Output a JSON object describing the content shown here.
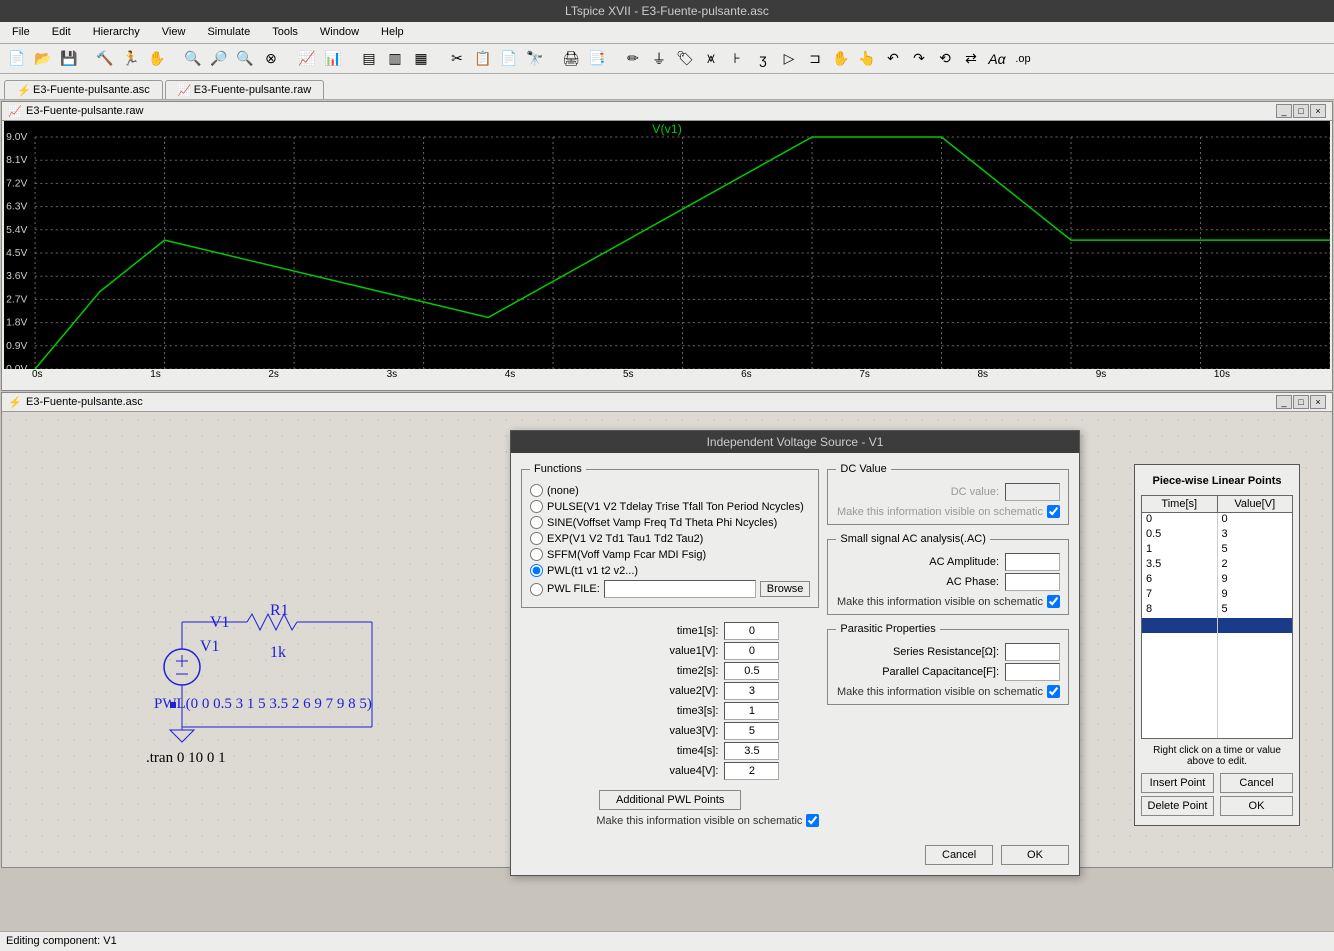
{
  "app": {
    "title": "LTspice XVII - E3-Fuente-pulsante.asc"
  },
  "menu": [
    "File",
    "Edit",
    "Hierarchy",
    "View",
    "Simulate",
    "Tools",
    "Window",
    "Help"
  ],
  "tabs": [
    {
      "label": "E3-Fuente-pulsante.asc"
    },
    {
      "label": "E3-Fuente-pulsante.raw"
    }
  ],
  "wave_pane_title": "E3-Fuente-pulsante.raw",
  "sch_pane_title": "E3-Fuente-pulsante.asc",
  "status": "Editing component: V1",
  "chart_data": {
    "type": "line",
    "title": "V(v1)",
    "xlabel": "",
    "ylabel": "",
    "xlim": [
      0,
      10
    ],
    "ylim": [
      0,
      9
    ],
    "x_ticks": [
      "0s",
      "1s",
      "2s",
      "3s",
      "4s",
      "5s",
      "6s",
      "7s",
      "8s",
      "9s",
      "10s"
    ],
    "y_ticks": [
      "0.0V",
      "0.9V",
      "1.8V",
      "2.7V",
      "3.6V",
      "4.5V",
      "5.4V",
      "6.3V",
      "7.2V",
      "8.1V",
      "9.0V"
    ],
    "series": [
      {
        "name": "V(v1)",
        "color": "#00c800",
        "x": [
          0,
          0.5,
          1,
          3.5,
          6,
          7,
          8,
          10
        ],
        "y": [
          0,
          3,
          5,
          2,
          9,
          9,
          5,
          5
        ]
      }
    ]
  },
  "schematic": {
    "r1_name": "R1",
    "r1_val": "1k",
    "v1_name": "V1",
    "v1_node": "V1",
    "pwl": "PWL(0 0 0.5 3 1 5 3.5 2 6 9 7 9 8 5)",
    "tran": ".tran 0 10 0 1"
  },
  "dlg": {
    "title": "Independent Voltage Source - V1",
    "functions_legend": "Functions",
    "fn_none": "(none)",
    "fn_pulse": "PULSE(V1 V2 Tdelay Trise Tfall Ton Period Ncycles)",
    "fn_sine": "SINE(Voffset Vamp Freq Td Theta Phi Ncycles)",
    "fn_exp": "EXP(V1 V2 Td1 Tau1 Td2 Tau2)",
    "fn_sffm": "SFFM(Voff Vamp Fcar MDI Fsig)",
    "fn_pwl": "PWL(t1 v1 t2 v2...)",
    "fn_pwlfile": "PWL FILE:",
    "browse": "Browse",
    "pwl_fields": [
      {
        "label": "time1[s]:",
        "val": "0"
      },
      {
        "label": "value1[V]:",
        "val": "0"
      },
      {
        "label": "time2[s]:",
        "val": "0.5"
      },
      {
        "label": "value2[V]:",
        "val": "3"
      },
      {
        "label": "time3[s]:",
        "val": "1"
      },
      {
        "label": "value3[V]:",
        "val": "5"
      },
      {
        "label": "time4[s]:",
        "val": "3.5"
      },
      {
        "label": "value4[V]:",
        "val": "2"
      }
    ],
    "addl_btn": "Additional PWL Points",
    "visible_chk": "Make this information visible on schematic",
    "dc_legend": "DC Value",
    "dc_label": "DC value:",
    "ac_legend": "Small signal AC analysis(.AC)",
    "ac_amp": "AC Amplitude:",
    "ac_phase": "AC Phase:",
    "par_legend": "Parasitic Properties",
    "par_r": "Series Resistance[Ω]:",
    "par_c": "Parallel Capacitance[F]:",
    "cancel": "Cancel",
    "ok": "OK"
  },
  "pwl": {
    "title": "Piece-wise Linear Points",
    "hdr_t": "Time[s]",
    "hdr_v": "Value[V]",
    "rows": [
      [
        "0",
        "0"
      ],
      [
        "0.5",
        "3"
      ],
      [
        "1",
        "5"
      ],
      [
        "3.5",
        "2"
      ],
      [
        "6",
        "9"
      ],
      [
        "7",
        "9"
      ],
      [
        "8",
        "5"
      ]
    ],
    "hint": "Right click on a time or value above to edit.",
    "insert": "Insert Point",
    "delete": "Delete Point",
    "cancel": "Cancel",
    "ok": "OK"
  }
}
